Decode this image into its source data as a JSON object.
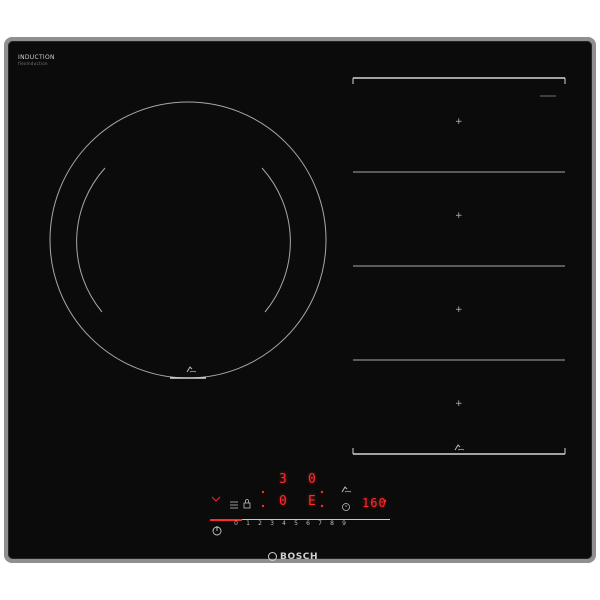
{
  "brand": {
    "model_label": "INDUCTION",
    "sub_label": "flexInduction",
    "logo_text": "BOSCH"
  },
  "zones": {
    "flex_plus_symbols": [
      "+",
      "+",
      "+",
      "+"
    ],
    "flex_label": "────────"
  },
  "display": {
    "zone1_level": "3",
    "zone2_level": "0",
    "zone3_level": "0",
    "zone4_level": "E",
    "timer_value": "160",
    "timer_unit_icon": "clock-icon"
  },
  "slider": {
    "numbers": [
      "0",
      "1",
      "2",
      "3",
      "4",
      "5",
      "6",
      "7",
      "8",
      "9"
    ]
  },
  "colors": {
    "glass": "#0b0b0b",
    "frame": "#8f8f8f",
    "display_red": "#ff2a2a",
    "print": "#c8c8c8"
  },
  "icons": [
    "power-icon",
    "pan-icon",
    "lock-icon",
    "menu-icon",
    "timer-icon",
    "clock-icon"
  ]
}
